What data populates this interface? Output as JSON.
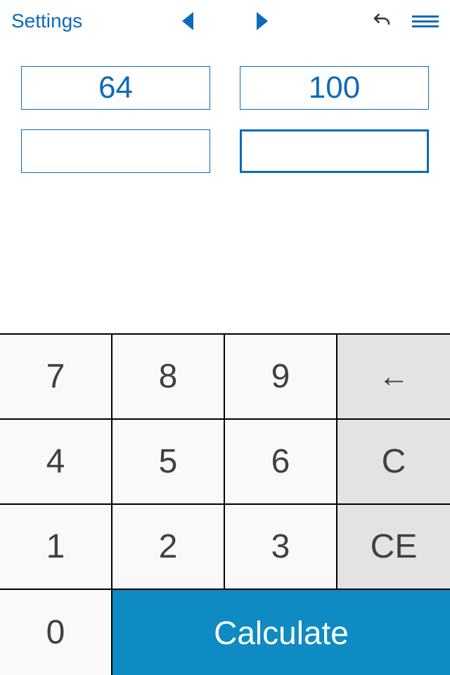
{
  "header": {
    "settings_label": "Settings"
  },
  "inputs": {
    "top_left": "64",
    "top_right": "100",
    "bottom_left": "",
    "bottom_right": ""
  },
  "keypad": {
    "k7": "7",
    "k8": "8",
    "k9": "9",
    "back": "←",
    "k4": "4",
    "k5": "5",
    "k6": "6",
    "clear": "C",
    "k1": "1",
    "k2": "2",
    "k3": "3",
    "clear_entry": "CE",
    "k0": "0",
    "calculate": "Calculate"
  }
}
